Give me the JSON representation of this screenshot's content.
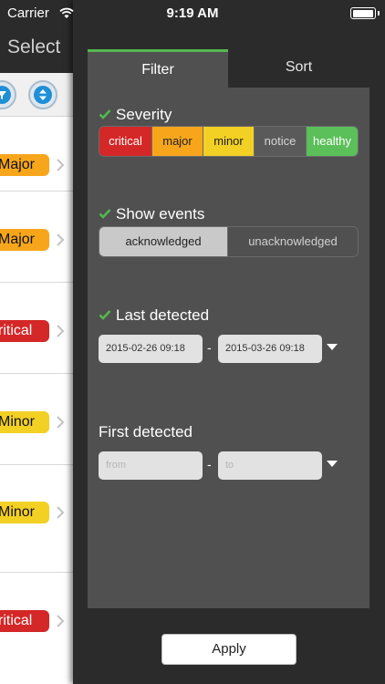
{
  "status_bar": {
    "carrier": "Carrier",
    "time": "9:19 AM"
  },
  "left": {
    "select_label": "Select",
    "rows": [
      {
        "severity": "Major",
        "color": "#f7a61c"
      },
      {
        "severity": "Major",
        "color": "#f7a61c"
      },
      {
        "severity": "ritical",
        "color": "#d42727"
      },
      {
        "severity": "Minor",
        "color": "#f2d024"
      },
      {
        "severity": "Minor",
        "color": "#f2d024"
      },
      {
        "severity": "ritical",
        "color": "#d42727"
      }
    ]
  },
  "tabs": {
    "filter": "Filter",
    "sort": "Sort",
    "active_color": "#53b84f"
  },
  "filter": {
    "severity": {
      "title": "Severity",
      "options": [
        "critical",
        "major",
        "minor",
        "notice",
        "healthy"
      ]
    },
    "show_events": {
      "title": "Show events",
      "options": [
        "acknowledged",
        "unacknowledged"
      ]
    },
    "last_detected": {
      "title": "Last detected",
      "from": "2015-02-26 09:18",
      "to": "2015-03-26 09:18",
      "separator": "-"
    },
    "first_detected": {
      "title": "First detected",
      "from_placeholder": "from",
      "to_placeholder": "to",
      "separator": "-"
    },
    "apply_label": "Apply"
  },
  "icons": {
    "wifi": "wifi-icon",
    "battery": "battery-icon",
    "check": "check-icon",
    "chevron": "chevron-right-icon",
    "caret": "caret-down-icon",
    "filter": "filter-icon",
    "sort": "sort-icon"
  }
}
